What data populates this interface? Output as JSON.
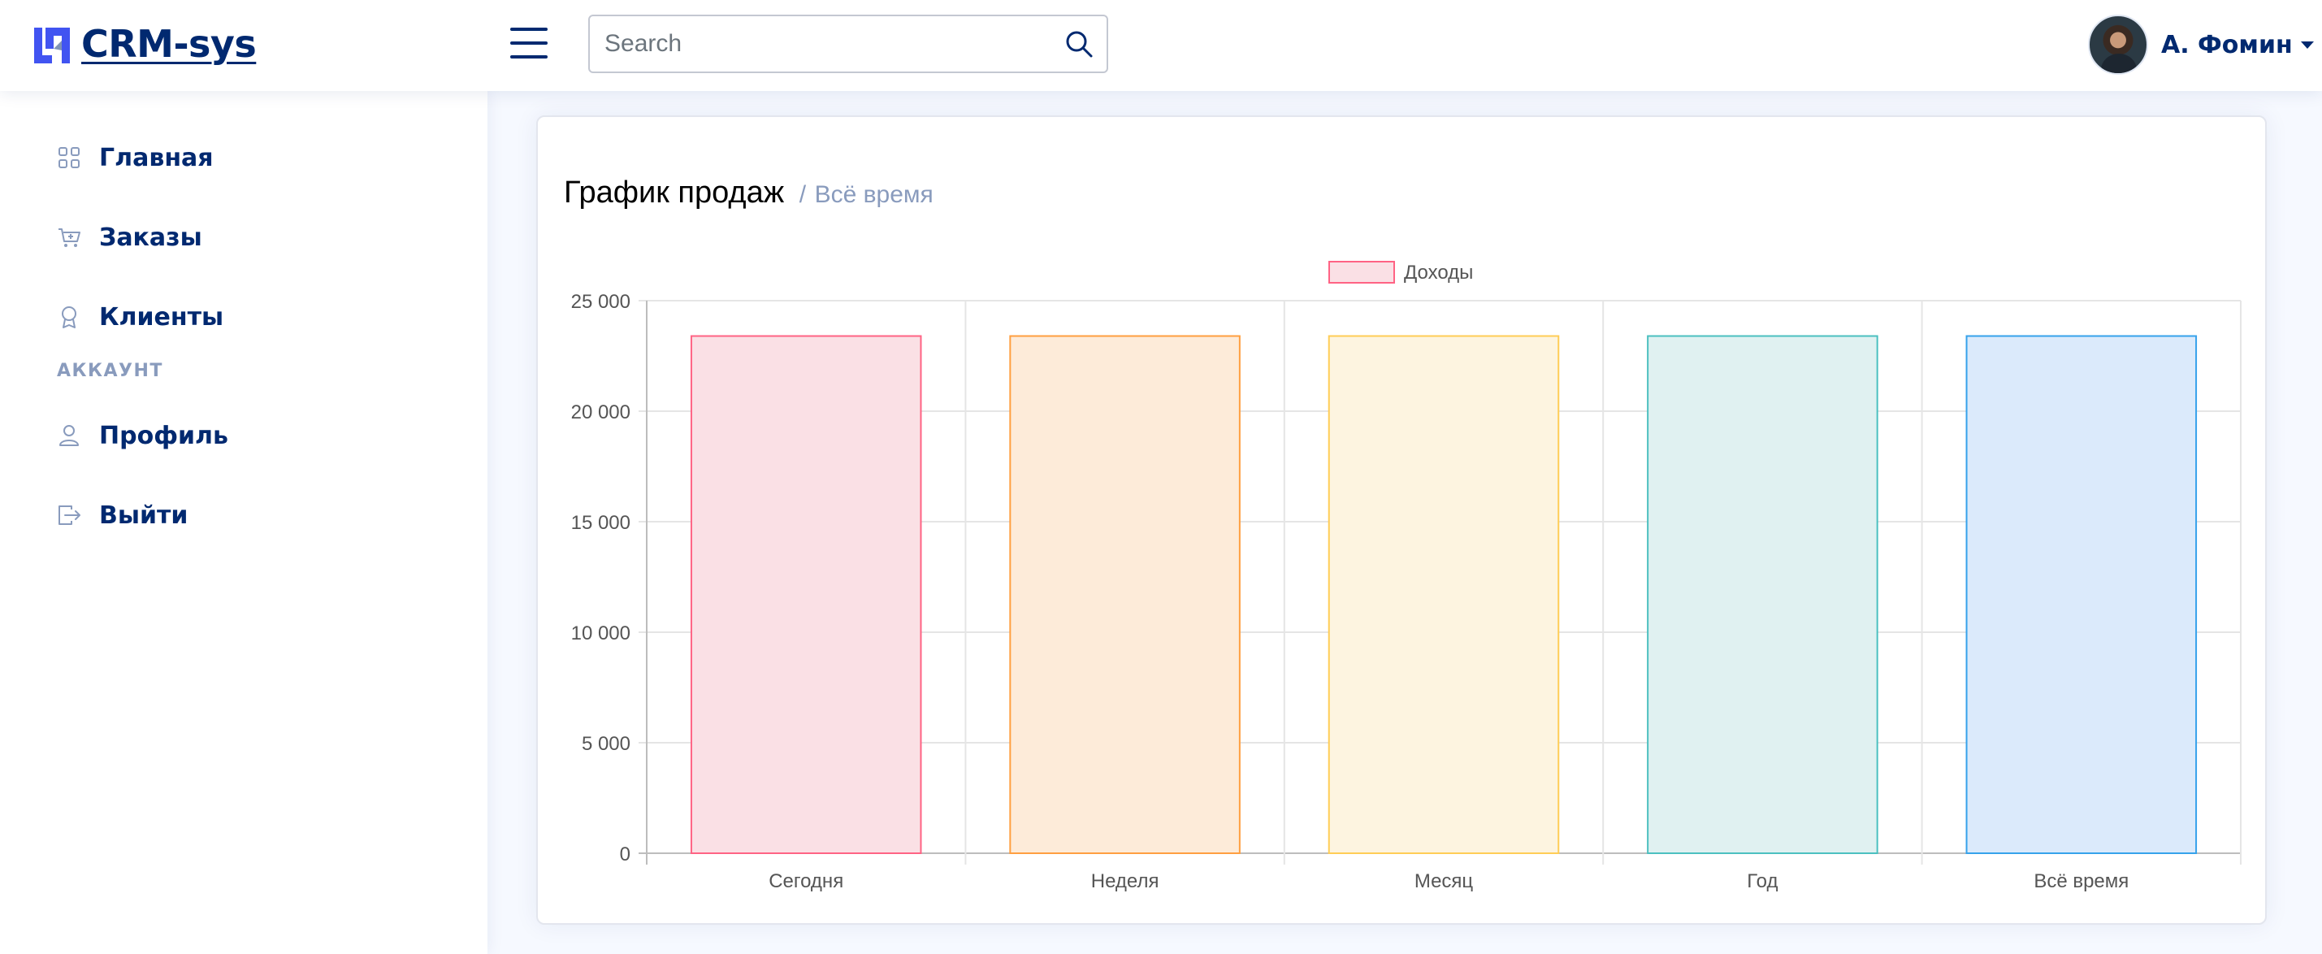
{
  "header": {
    "logo_text": "CRM-sys",
    "search_placeholder": "Search",
    "user_name": "А. Фомин"
  },
  "sidebar": {
    "items": [
      {
        "label": "Главная",
        "icon": "grid-icon"
      },
      {
        "label": "Заказы",
        "icon": "cart-icon"
      },
      {
        "label": "Клиенты",
        "icon": "award-icon"
      }
    ],
    "heading": "АККАУНТ",
    "account_items": [
      {
        "label": "Профиль",
        "icon": "person-icon"
      },
      {
        "label": "Выйти",
        "icon": "logout-icon"
      }
    ]
  },
  "card": {
    "title": "График продаж",
    "separator": "/",
    "subtitle": "Всё время"
  },
  "chart_data": {
    "type": "bar",
    "categories": [
      "Сегодня",
      "Неделя",
      "Месяц",
      "Год",
      "Всё время"
    ],
    "series": [
      {
        "name": "Доходы",
        "values": [
          23400,
          23400,
          23400,
          23400,
          23400
        ]
      }
    ],
    "ylim": [
      0,
      25000
    ],
    "yticks": [
      "0",
      "5 000",
      "10 000",
      "15 000",
      "20 000",
      "25 000"
    ],
    "ytick_values": [
      0,
      5000,
      10000,
      15000,
      20000,
      25000
    ],
    "grid": true,
    "legend_position": "top-center",
    "bar_fills": [
      "#fae0e5",
      "#fdebd9",
      "#fdf4e0",
      "#e0f1f1",
      "#dbeafb"
    ],
    "bar_strokes": [
      "#ff6384",
      "#ff9f40",
      "#ffcd56",
      "#4bc0c0",
      "#36a2eb"
    ]
  }
}
